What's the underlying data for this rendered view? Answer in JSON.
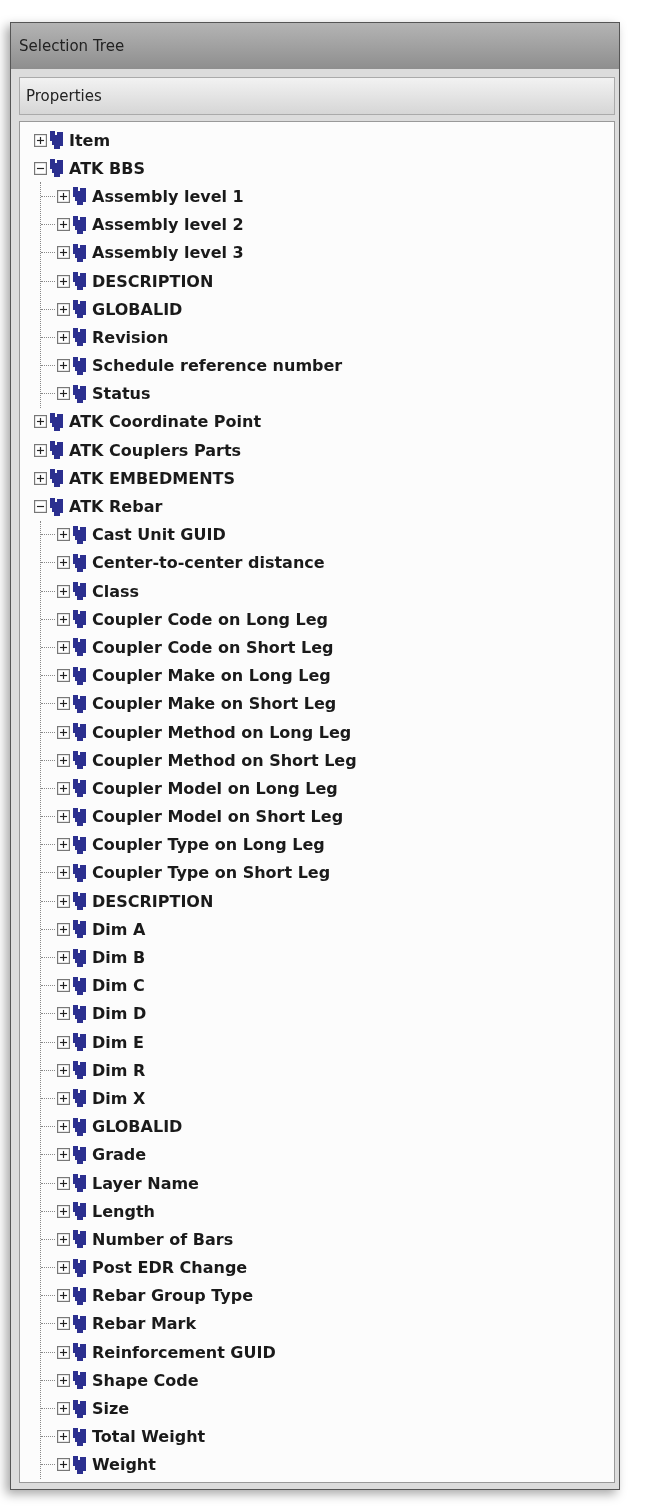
{
  "window": {
    "title": "Selection Tree"
  },
  "header": {
    "label": "Properties"
  },
  "tree": [
    {
      "label": "Item",
      "expanded": false
    },
    {
      "label": "ATK BBS",
      "expanded": true,
      "children": [
        {
          "label": "Assembly level 1",
          "expanded": false
        },
        {
          "label": "Assembly level 2",
          "expanded": false
        },
        {
          "label": "Assembly level 3",
          "expanded": false
        },
        {
          "label": "DESCRIPTION",
          "expanded": false
        },
        {
          "label": "GLOBALID",
          "expanded": false
        },
        {
          "label": "Revision",
          "expanded": false
        },
        {
          "label": "Schedule reference number",
          "expanded": false
        },
        {
          "label": "Status",
          "expanded": false
        }
      ]
    },
    {
      "label": "ATK Coordinate Point",
      "expanded": false
    },
    {
      "label": "ATK Couplers Parts",
      "expanded": false
    },
    {
      "label": "ATK EMBEDMENTS",
      "expanded": false
    },
    {
      "label": "ATK Rebar",
      "expanded": true,
      "children": [
        {
          "label": "Cast Unit GUID",
          "expanded": false
        },
        {
          "label": "Center-to-center distance",
          "expanded": false
        },
        {
          "label": "Class",
          "expanded": false
        },
        {
          "label": "Coupler Code on Long Leg",
          "expanded": false
        },
        {
          "label": "Coupler Code on Short Leg",
          "expanded": false
        },
        {
          "label": "Coupler Make on Long Leg",
          "expanded": false
        },
        {
          "label": "Coupler Make on Short Leg",
          "expanded": false
        },
        {
          "label": "Coupler Method on Long Leg",
          "expanded": false
        },
        {
          "label": "Coupler Method on Short Leg",
          "expanded": false
        },
        {
          "label": "Coupler Model on Long Leg",
          "expanded": false
        },
        {
          "label": "Coupler Model on Short Leg",
          "expanded": false
        },
        {
          "label": "Coupler Type on Long Leg",
          "expanded": false
        },
        {
          "label": "Coupler Type on Short Leg",
          "expanded": false
        },
        {
          "label": "DESCRIPTION",
          "expanded": false
        },
        {
          "label": "Dim A",
          "expanded": false
        },
        {
          "label": "Dim B",
          "expanded": false
        },
        {
          "label": "Dim C",
          "expanded": false
        },
        {
          "label": "Dim D",
          "expanded": false
        },
        {
          "label": "Dim E",
          "expanded": false
        },
        {
          "label": "Dim R",
          "expanded": false
        },
        {
          "label": "Dim X",
          "expanded": false
        },
        {
          "label": "GLOBALID",
          "expanded": false
        },
        {
          "label": "Grade",
          "expanded": false
        },
        {
          "label": "Layer Name",
          "expanded": false
        },
        {
          "label": "Length",
          "expanded": false
        },
        {
          "label": "Number of Bars",
          "expanded": false
        },
        {
          "label": "Post EDR Change",
          "expanded": false
        },
        {
          "label": "Rebar Group Type",
          "expanded": false
        },
        {
          "label": "Rebar Mark",
          "expanded": false
        },
        {
          "label": "Reinforcement GUID",
          "expanded": false
        },
        {
          "label": "Shape Code",
          "expanded": false
        },
        {
          "label": "Size",
          "expanded": false
        },
        {
          "label": "Total Weight",
          "expanded": false
        },
        {
          "label": "Weight",
          "expanded": false
        }
      ]
    }
  ]
}
